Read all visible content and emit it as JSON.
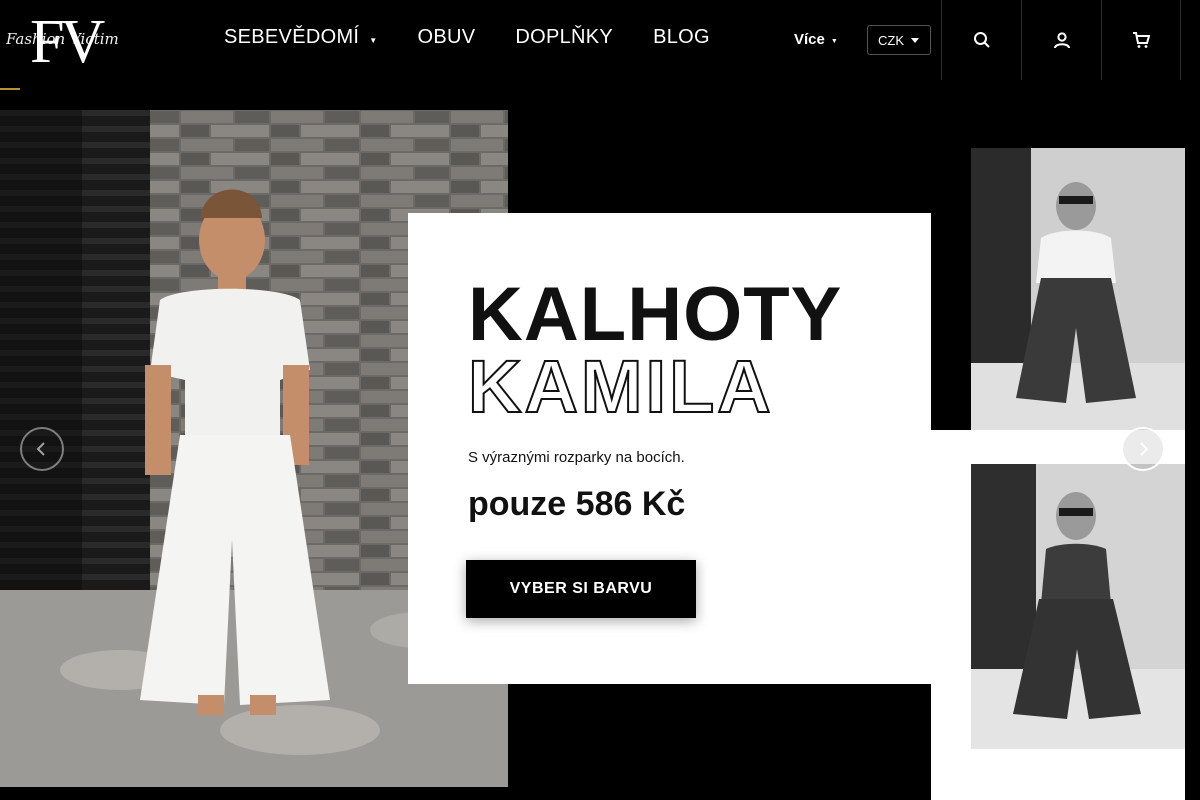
{
  "logo": {
    "text": "FV",
    "script_text": "Fashion Victim"
  },
  "nav": {
    "items": [
      {
        "label": "SEBEVĚDOMÍ",
        "has_dropdown": true
      },
      {
        "label": "OBUV",
        "has_dropdown": false
      },
      {
        "label": "DOPLŇKY",
        "has_dropdown": false
      },
      {
        "label": "BLOG",
        "has_dropdown": false
      }
    ],
    "more_label": "Více",
    "currency": "CZK"
  },
  "header_icons": [
    "search-icon",
    "user-icon",
    "cart-icon"
  ],
  "hero": {
    "title_line1": "KALHOTY",
    "title_line2": "KAMILA",
    "subtitle": "S výraznými rozparky na bocích.",
    "price": "pouze 586 Kč",
    "cta_label": "VYBER SI BARVU"
  },
  "colors": {
    "background": "#000000",
    "accent": "#b8932f",
    "card": "#ffffff",
    "text": "#111111"
  }
}
